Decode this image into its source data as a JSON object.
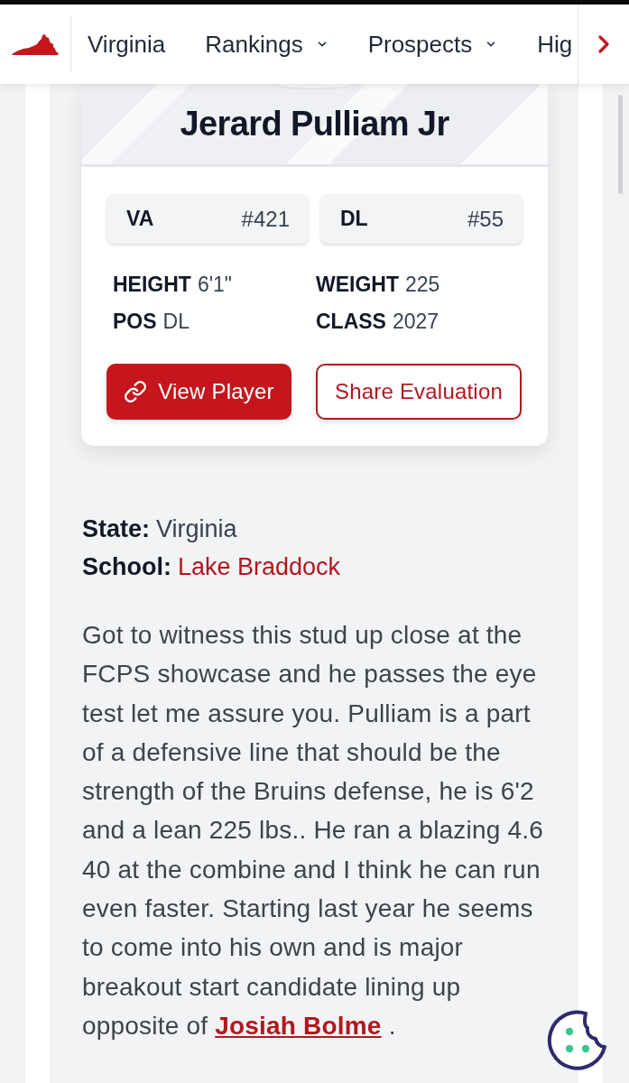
{
  "nav": {
    "items": [
      {
        "label": "Virginia",
        "has_menu": false
      },
      {
        "label": "Rankings",
        "has_menu": true
      },
      {
        "label": "Prospects",
        "has_menu": true
      },
      {
        "label": "Hig",
        "has_menu": false
      }
    ]
  },
  "player_card": {
    "name": "Jerard Pulliam Jr",
    "ranks": [
      {
        "label": "VA",
        "value": "#421"
      },
      {
        "label": "DL",
        "value": "#55"
      }
    ],
    "stats": [
      {
        "label": "HEIGHT",
        "value": "6'1\""
      },
      {
        "label": "WEIGHT",
        "value": "225"
      },
      {
        "label": "POS",
        "value": "DL"
      },
      {
        "label": "CLASS",
        "value": "2027"
      }
    ],
    "buttons": [
      {
        "label": "View Player",
        "kind": "primary"
      },
      {
        "label": "Share Evaluation",
        "kind": "outline"
      }
    ]
  },
  "details": [
    {
      "label": "State:",
      "value": "Virginia",
      "kind": "text"
    },
    {
      "label": "School:",
      "value": "Lake Braddock",
      "kind": "link"
    }
  ],
  "evaluation": {
    "text": "Got to witness this stud up close at the FCPS showcase and he passes the eye test let me assure you. Pulliam is a part of a defensive line that should be the strength of the Bruins defense, he is 6'2 and a lean 225 lbs.. He ran a blazing 4.6 40 at the combine and I think he can run even faster. Starting last year he seems to come into his own and is major breakout start candidate lining up opposite of",
    "link": "Josiah Bolme",
    "after": " ."
  }
}
